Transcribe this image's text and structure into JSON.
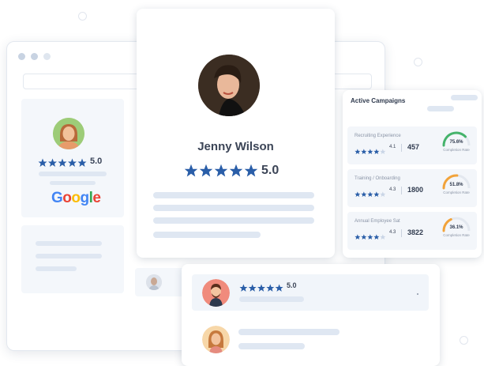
{
  "left_review": {
    "rating": "5.0",
    "brand": [
      "G",
      "o",
      "o",
      "g",
      "l",
      "e"
    ],
    "brand_colors": [
      "#4285F4",
      "#EA4335",
      "#FBBC05",
      "#4285F4",
      "#34A853",
      "#EA4335"
    ]
  },
  "profile": {
    "name": "Jenny Wilson",
    "rating": "5.0"
  },
  "campaigns": {
    "title": "Active Campaigns",
    "items": [
      {
        "label": "Recruiting Experience",
        "score": "4.1",
        "count": "457",
        "percent": "75.6%",
        "fraction": 0.756,
        "caption": "Completion Rate",
        "color": "#45b36b"
      },
      {
        "label": "Training / Onboarding",
        "score": "4.3",
        "count": "1800",
        "percent": "51.8%",
        "fraction": 0.518,
        "caption": "Completion Rate",
        "color": "#f2a33a"
      },
      {
        "label": "Annual Employee Sat",
        "score": "4.3",
        "count": "3822",
        "percent": "36.1%",
        "fraction": 0.361,
        "caption": "Completion Rate",
        "color": "#f2a33a"
      }
    ]
  },
  "bottom_review": {
    "rating": "5.0"
  },
  "colors": {
    "accent": "#2a5ea8",
    "skeleton": "#dfe7f2"
  }
}
